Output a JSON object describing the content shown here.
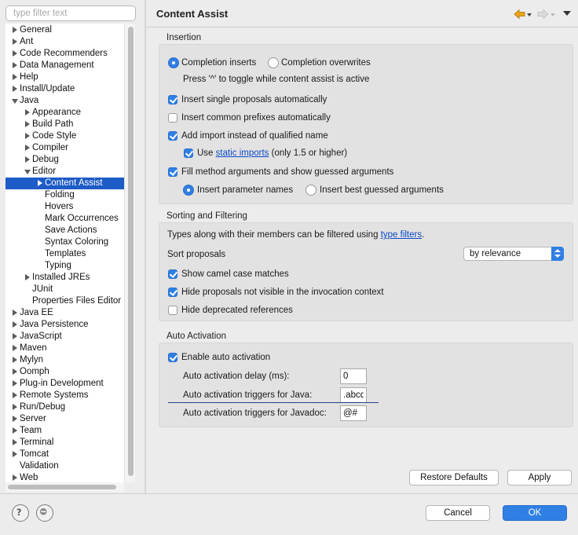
{
  "filter": {
    "placeholder": "type filter text"
  },
  "tree": [
    {
      "label": "General",
      "level": 0,
      "expander": "right"
    },
    {
      "label": "Ant",
      "level": 0,
      "expander": "right"
    },
    {
      "label": "Code Recommenders",
      "level": 0,
      "expander": "right"
    },
    {
      "label": "Data Management",
      "level": 0,
      "expander": "right"
    },
    {
      "label": "Help",
      "level": 0,
      "expander": "right"
    },
    {
      "label": "Install/Update",
      "level": 0,
      "expander": "right"
    },
    {
      "label": "Java",
      "level": 0,
      "expander": "down"
    },
    {
      "label": "Appearance",
      "level": 1,
      "expander": "right"
    },
    {
      "label": "Build Path",
      "level": 1,
      "expander": "right"
    },
    {
      "label": "Code Style",
      "level": 1,
      "expander": "right"
    },
    {
      "label": "Compiler",
      "level": 1,
      "expander": "right"
    },
    {
      "label": "Debug",
      "level": 1,
      "expander": "right"
    },
    {
      "label": "Editor",
      "level": 1,
      "expander": "down"
    },
    {
      "label": "Content Assist",
      "level": 2,
      "expander": "right",
      "selected": true
    },
    {
      "label": "Folding",
      "level": 2,
      "expander": "none"
    },
    {
      "label": "Hovers",
      "level": 2,
      "expander": "none"
    },
    {
      "label": "Mark Occurrences",
      "level": 2,
      "expander": "none"
    },
    {
      "label": "Save Actions",
      "level": 2,
      "expander": "none"
    },
    {
      "label": "Syntax Coloring",
      "level": 2,
      "expander": "none"
    },
    {
      "label": "Templates",
      "level": 2,
      "expander": "none"
    },
    {
      "label": "Typing",
      "level": 2,
      "expander": "none"
    },
    {
      "label": "Installed JREs",
      "level": 1,
      "expander": "right"
    },
    {
      "label": "JUnit",
      "level": 1,
      "expander": "none"
    },
    {
      "label": "Properties Files Editor",
      "level": 1,
      "expander": "none"
    },
    {
      "label": "Java EE",
      "level": 0,
      "expander": "right"
    },
    {
      "label": "Java Persistence",
      "level": 0,
      "expander": "right"
    },
    {
      "label": "JavaScript",
      "level": 0,
      "expander": "right"
    },
    {
      "label": "Maven",
      "level": 0,
      "expander": "right"
    },
    {
      "label": "Mylyn",
      "level": 0,
      "expander": "right"
    },
    {
      "label": "Oomph",
      "level": 0,
      "expander": "right"
    },
    {
      "label": "Plug-in Development",
      "level": 0,
      "expander": "right"
    },
    {
      "label": "Remote Systems",
      "level": 0,
      "expander": "right"
    },
    {
      "label": "Run/Debug",
      "level": 0,
      "expander": "right"
    },
    {
      "label": "Server",
      "level": 0,
      "expander": "right"
    },
    {
      "label": "Team",
      "level": 0,
      "expander": "right"
    },
    {
      "label": "Terminal",
      "level": 0,
      "expander": "right"
    },
    {
      "label": "Tomcat",
      "level": 0,
      "expander": "right"
    },
    {
      "label": "Validation",
      "level": 0,
      "expander": "none"
    },
    {
      "label": "Web",
      "level": 0,
      "expander": "right"
    }
  ],
  "page": {
    "title": "Content Assist"
  },
  "insertion": {
    "label": "Insertion",
    "completion_inserts": {
      "label": "Completion inserts",
      "selected": true
    },
    "completion_overwrites": {
      "label": "Completion overwrites",
      "selected": false
    },
    "toggle_hint": "Press '^' to toggle while content assist is active",
    "insert_single": {
      "label": "Insert single proposals automatically",
      "checked": true
    },
    "insert_common": {
      "label": "Insert common prefixes automatically",
      "checked": false
    },
    "add_import": {
      "label": "Add import instead of qualified name",
      "checked": true
    },
    "use_static": {
      "prefix": "Use",
      "link": "static imports",
      "suffix": "(only 1.5 or higher)",
      "checked": true
    },
    "fill_args": {
      "label": "Fill method arguments and show guessed arguments",
      "checked": true
    },
    "param_names": {
      "label": "Insert parameter names",
      "selected": true
    },
    "best_guessed": {
      "label": "Insert best guessed arguments",
      "selected": false
    }
  },
  "sorting": {
    "label": "Sorting and Filtering",
    "types_prefix": "Types along with their members can be filtered using",
    "types_link": "type filters",
    "types_suffix": ".",
    "sort_label": "Sort proposals",
    "sort_value": "by relevance",
    "camel": {
      "label": "Show camel case matches",
      "checked": true
    },
    "hide_not_visible": {
      "label": "Hide proposals not visible in the invocation context",
      "checked": true
    },
    "hide_deprecated": {
      "label": "Hide deprecated references",
      "checked": false
    }
  },
  "activation": {
    "label": "Auto Activation",
    "enable": {
      "label": "Enable auto activation",
      "checked": true
    },
    "delay_label": "Auto activation delay (ms):",
    "delay_value": "0",
    "java_label": "Auto activation triggers for Java:",
    "java_value": ".abcdefghijklmnopqrstuvwxyz",
    "javadoc_label": "Auto activation triggers for Javadoc:",
    "javadoc_value": "@#"
  },
  "buttons": {
    "restore": "Restore Defaults",
    "apply": "Apply",
    "cancel": "Cancel",
    "ok": "OK"
  },
  "colors": {
    "accent": "#2f7fe4",
    "selection": "#1d5bc7",
    "link": "#0b49c6",
    "nav_arrow": "#e8a317"
  }
}
